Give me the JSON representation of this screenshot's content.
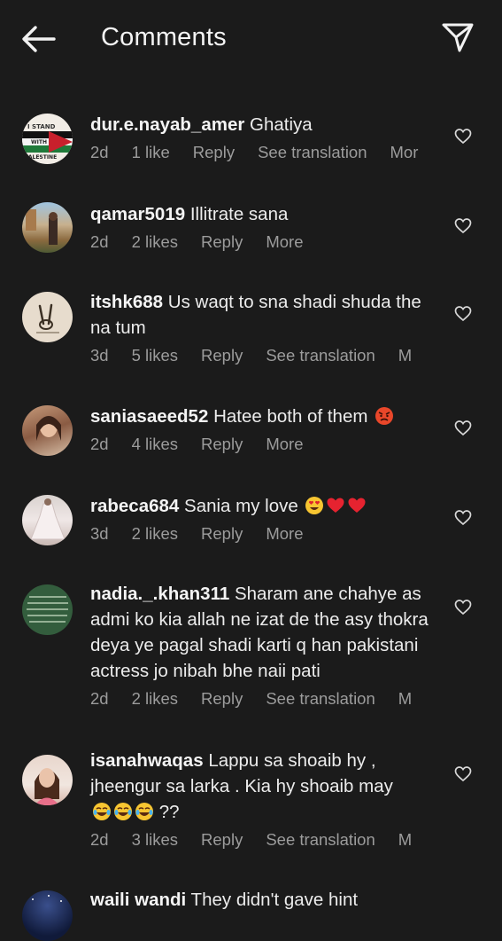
{
  "header": {
    "title": "Comments"
  },
  "comments": [
    {
      "username": "dur.e.nayab_amer",
      "text": "Ghatiya",
      "time": "2d",
      "likes": "1 like",
      "reply": "Reply",
      "extra": "See translation",
      "more": "Mor",
      "avatar": "i-stand-with-palestine-avatar"
    },
    {
      "username": "qamar5019",
      "text": "Illitrate sana",
      "time": "2d",
      "likes": "2 likes",
      "reply": "Reply",
      "extra": "More",
      "avatar": "outdoor-photo-avatar"
    },
    {
      "username": "itshk688",
      "text": "Us waqt to sna shadi shuda the na tum",
      "time": "3d",
      "likes": "5 likes",
      "reply": "Reply",
      "extra": "See translation",
      "more": "M",
      "avatar": "peace-sign-avatar"
    },
    {
      "username": "saniasaeed52",
      "text": "Hatee both of them",
      "time": "2d",
      "likes": "4 likes",
      "reply": "Reply",
      "extra": "More",
      "avatar": "selfie-avatar"
    },
    {
      "username": "rabeca684",
      "text": "Sania my love",
      "time": "3d",
      "likes": "2 likes",
      "reply": "Reply",
      "extra": "More",
      "avatar": "dress-photo-avatar"
    },
    {
      "username": "nadia._.khan311",
      "text": "Sharam ane chahye as admi ko kia allah ne izat de the asy thokra deya ye pagal shadi karti q han pakistani actress jo nibah bhe naii pati",
      "time": "2d",
      "likes": "2 likes",
      "reply": "Reply",
      "extra": "See translation",
      "more": "M",
      "avatar": "calligraphy-avatar"
    },
    {
      "username": "isanahwaqas",
      "text": "Lappu sa shoaib hy , jheengur sa larka . Kia hy shoaib may",
      "text2": "??",
      "time": "2d",
      "likes": "3 likes",
      "reply": "Reply",
      "extra": "See translation",
      "more": "M",
      "avatar": "portrait-avatar"
    },
    {
      "username": "waili wandi",
      "text": "They didn't gave hint",
      "avatar": "night-sky-avatar"
    }
  ],
  "colors": {
    "background": "#1b1b1b",
    "text": "#f2f2f2",
    "meta": "#9c9c9c"
  }
}
